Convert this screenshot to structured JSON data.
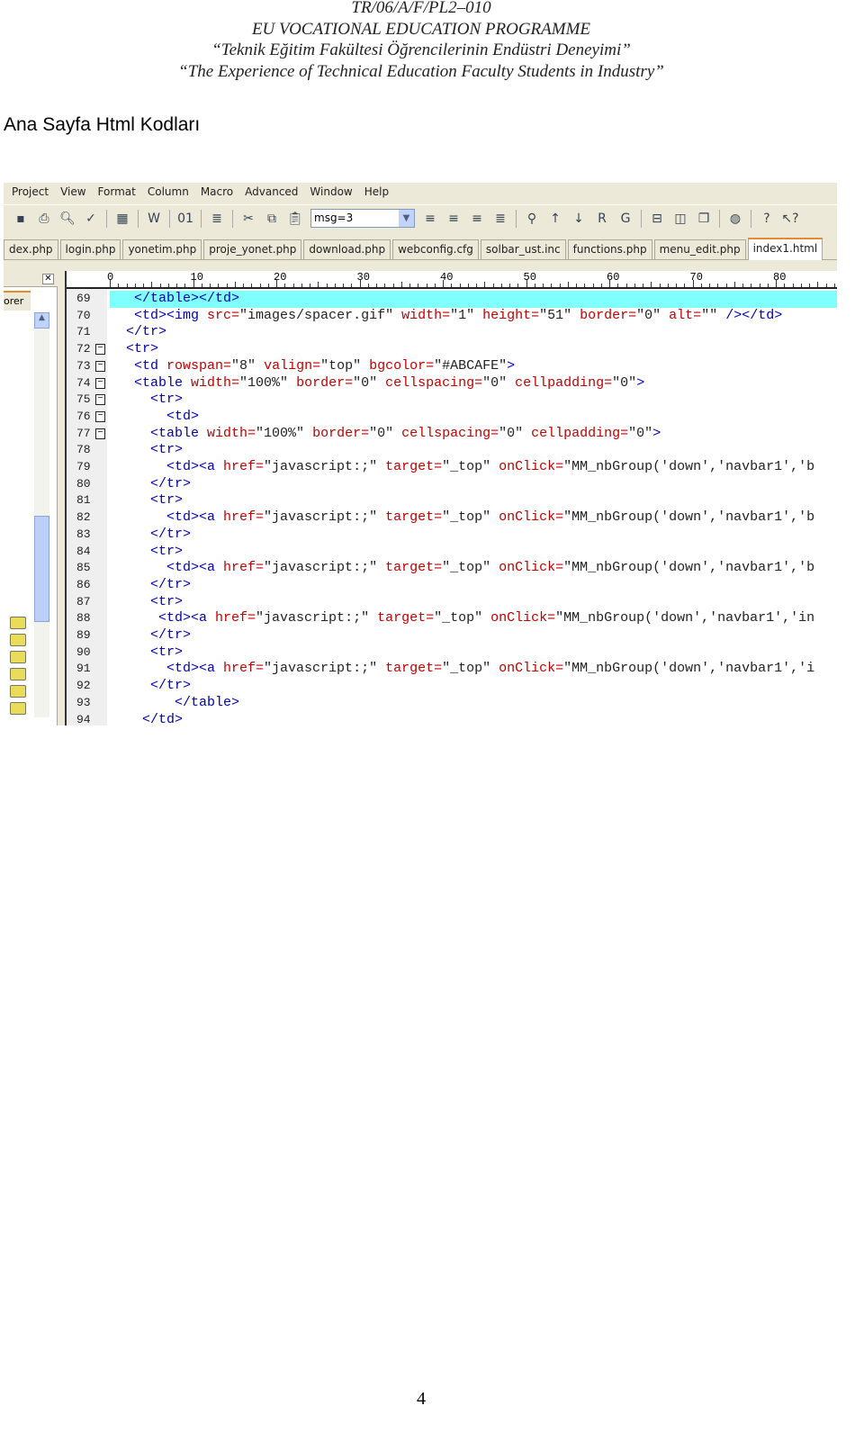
{
  "document": {
    "header_lines": [
      "TR/06/A/F/PL2–010",
      "EU VOCATIONAL EDUCATION PROGRAMME",
      "“Teknik Eğitim Fakültesi Öğrencilerinin Endüstri Deneyimi”",
      "“The Experience of Technical Education Faculty Students in Industry”"
    ],
    "heading": "Ana Sayfa Html Kodları",
    "page_number": "4"
  },
  "editor": {
    "menu": [
      "Project",
      "View",
      "Format",
      "Column",
      "Macro",
      "Advanced",
      "Window",
      "Help"
    ],
    "toolbar": {
      "icons_left": [
        "save-icon",
        "print-icon",
        "print-preview-icon",
        "spell-check-icon",
        "sep",
        "hex-icon",
        "sep",
        "word-wrap-icon",
        "sep",
        "binary-icon",
        "sep",
        "format-icon",
        "sep",
        "cut-icon",
        "copy-icon",
        "paste-icon"
      ],
      "combo_value": "msg=3",
      "icons_right": [
        "align-left-icon",
        "align-center-icon",
        "align-right-icon",
        "justify-icon",
        "sep",
        "find-icon",
        "find-prev-icon",
        "find-next-icon",
        "replace-icon",
        "goto-icon",
        "sep",
        "horizontal-split-icon",
        "vertical-split-icon",
        "cascade-icon",
        "sep",
        "ftp-icon",
        "sep",
        "help-icon",
        "context-help-icon"
      ]
    },
    "tabs": [
      "dex.php",
      "login.php",
      "yonetim.php",
      "proje_yonet.php",
      "download.php",
      "webconfig.cfg",
      "solbar_ust.inc",
      "functions.php",
      "menu_edit.php",
      "index1.html"
    ],
    "active_tab": "index1.html",
    "side_panel_tab": "orer",
    "ruler_labels": [
      "0",
      "10",
      "20",
      "30",
      "40",
      "50",
      "60",
      "70",
      "80"
    ],
    "highlight_color": "#80FFFF",
    "colors": {
      "tag": "#0000B0",
      "attribute": "#C00000",
      "value": "#222222"
    },
    "lines": [
      {
        "n": "69",
        "indent": 3,
        "hl": true,
        "t": [
          [
            "tag",
            "</table></td>"
          ]
        ]
      },
      {
        "n": "70",
        "indent": 3,
        "t": [
          [
            "tag",
            "<td><img "
          ],
          [
            "attr",
            "src="
          ],
          [
            "val",
            "\"images/spacer.gif\""
          ],
          [
            "attr",
            " width="
          ],
          [
            "val",
            "\"1\""
          ],
          [
            "attr",
            " height="
          ],
          [
            "val",
            "\"51\""
          ],
          [
            "attr",
            " border="
          ],
          [
            "val",
            "\"0\""
          ],
          [
            "attr",
            " alt="
          ],
          [
            "val",
            "\"\""
          ],
          [
            "tag",
            " /></td>"
          ]
        ]
      },
      {
        "n": "71",
        "indent": 2,
        "t": [
          [
            "tag",
            "</tr>"
          ]
        ]
      },
      {
        "n": "72",
        "indent": 2,
        "fold": true,
        "t": [
          [
            "tag",
            "<tr>"
          ]
        ]
      },
      {
        "n": "73",
        "indent": 3,
        "fold": true,
        "t": [
          [
            "tag",
            "<td "
          ],
          [
            "attr",
            "rowspan="
          ],
          [
            "val",
            "\"8\""
          ],
          [
            "attr",
            " valign="
          ],
          [
            "val",
            "\"top\""
          ],
          [
            "attr",
            " bgcolor="
          ],
          [
            "val",
            "\"#ABCAFE\""
          ],
          [
            "tag",
            ">"
          ]
        ]
      },
      {
        "n": "74",
        "indent": 3,
        "fold": true,
        "t": [
          [
            "tag",
            "<table "
          ],
          [
            "attr",
            "width="
          ],
          [
            "val",
            "\"100%\""
          ],
          [
            "attr",
            " border="
          ],
          [
            "val",
            "\"0\""
          ],
          [
            "attr",
            " cellspacing="
          ],
          [
            "val",
            "\"0\""
          ],
          [
            "attr",
            " cellpadding="
          ],
          [
            "val",
            "\"0\""
          ],
          [
            "tag",
            ">"
          ]
        ]
      },
      {
        "n": "75",
        "indent": 5,
        "fold": true,
        "t": [
          [
            "tag",
            "<tr>"
          ]
        ]
      },
      {
        "n": "76",
        "indent": 7,
        "fold": true,
        "t": [
          [
            "tag",
            "<td>"
          ]
        ]
      },
      {
        "n": "77",
        "indent": 5,
        "fold": true,
        "t": [
          [
            "tag",
            "<table "
          ],
          [
            "attr",
            "width="
          ],
          [
            "val",
            "\"100%\""
          ],
          [
            "attr",
            " border="
          ],
          [
            "val",
            "\"0\""
          ],
          [
            "attr",
            " cellspacing="
          ],
          [
            "val",
            "\"0\""
          ],
          [
            "attr",
            " cellpadding="
          ],
          [
            "val",
            "\"0\""
          ],
          [
            "tag",
            ">"
          ]
        ]
      },
      {
        "n": "78",
        "indent": 5,
        "t": [
          [
            "tag",
            "<tr>"
          ]
        ]
      },
      {
        "n": "79",
        "indent": 7,
        "t": [
          [
            "tag",
            "<td><a "
          ],
          [
            "attr",
            "href="
          ],
          [
            "val",
            "\"javascript:;\""
          ],
          [
            "attr",
            " target="
          ],
          [
            "val",
            "\"_top\""
          ],
          [
            "attr",
            " onClick="
          ],
          [
            "val",
            "\"MM_nbGroup('down','navbar1','b"
          ]
        ]
      },
      {
        "n": "80",
        "indent": 5,
        "t": [
          [
            "tag",
            "</tr>"
          ]
        ]
      },
      {
        "n": "81",
        "indent": 5,
        "t": [
          [
            "tag",
            "<tr>"
          ]
        ]
      },
      {
        "n": "82",
        "indent": 7,
        "t": [
          [
            "tag",
            "<td><a "
          ],
          [
            "attr",
            "href="
          ],
          [
            "val",
            "\"javascript:;\""
          ],
          [
            "attr",
            " target="
          ],
          [
            "val",
            "\"_top\""
          ],
          [
            "attr",
            " onClick="
          ],
          [
            "val",
            "\"MM_nbGroup('down','navbar1','b"
          ]
        ]
      },
      {
        "n": "83",
        "indent": 5,
        "t": [
          [
            "tag",
            "</tr>"
          ]
        ]
      },
      {
        "n": "84",
        "indent": 5,
        "t": [
          [
            "tag",
            "<tr>"
          ]
        ]
      },
      {
        "n": "85",
        "indent": 7,
        "t": [
          [
            "tag",
            "<td><a "
          ],
          [
            "attr",
            "href="
          ],
          [
            "val",
            "\"javascript:;\""
          ],
          [
            "attr",
            " target="
          ],
          [
            "val",
            "\"_top\""
          ],
          [
            "attr",
            " onClick="
          ],
          [
            "val",
            "\"MM_nbGroup('down','navbar1','b"
          ]
        ]
      },
      {
        "n": "86",
        "indent": 5,
        "t": [
          [
            "tag",
            "</tr>"
          ]
        ]
      },
      {
        "n": "87",
        "indent": 5,
        "t": [
          [
            "tag",
            "<tr>"
          ]
        ]
      },
      {
        "n": "88",
        "indent": 6,
        "t": [
          [
            "tag",
            "<td><a "
          ],
          [
            "attr",
            "href="
          ],
          [
            "val",
            "\"javascript:;\""
          ],
          [
            "attr",
            " target="
          ],
          [
            "val",
            "\"_top\""
          ],
          [
            "attr",
            " onClick="
          ],
          [
            "val",
            "\"MM_nbGroup('down','navbar1','in"
          ]
        ]
      },
      {
        "n": "89",
        "indent": 5,
        "t": [
          [
            "tag",
            "</tr>"
          ]
        ]
      },
      {
        "n": "90",
        "indent": 5,
        "t": [
          [
            "tag",
            "<tr>"
          ]
        ]
      },
      {
        "n": "91",
        "indent": 7,
        "t": [
          [
            "tag",
            "<td><a "
          ],
          [
            "attr",
            "href="
          ],
          [
            "val",
            "\"javascript:;\""
          ],
          [
            "attr",
            " target="
          ],
          [
            "val",
            "\"_top\""
          ],
          [
            "attr",
            " onClick="
          ],
          [
            "val",
            "\"MM_nbGroup('down','navbar1','i"
          ]
        ]
      },
      {
        "n": "92",
        "indent": 5,
        "t": [
          [
            "tag",
            "</tr>"
          ]
        ]
      },
      {
        "n": "93",
        "indent": 8,
        "t": [
          [
            "tag",
            "</table>"
          ]
        ]
      },
      {
        "n": "94",
        "indent": 4,
        "t": [
          [
            "tag",
            "</td>"
          ]
        ]
      }
    ]
  }
}
